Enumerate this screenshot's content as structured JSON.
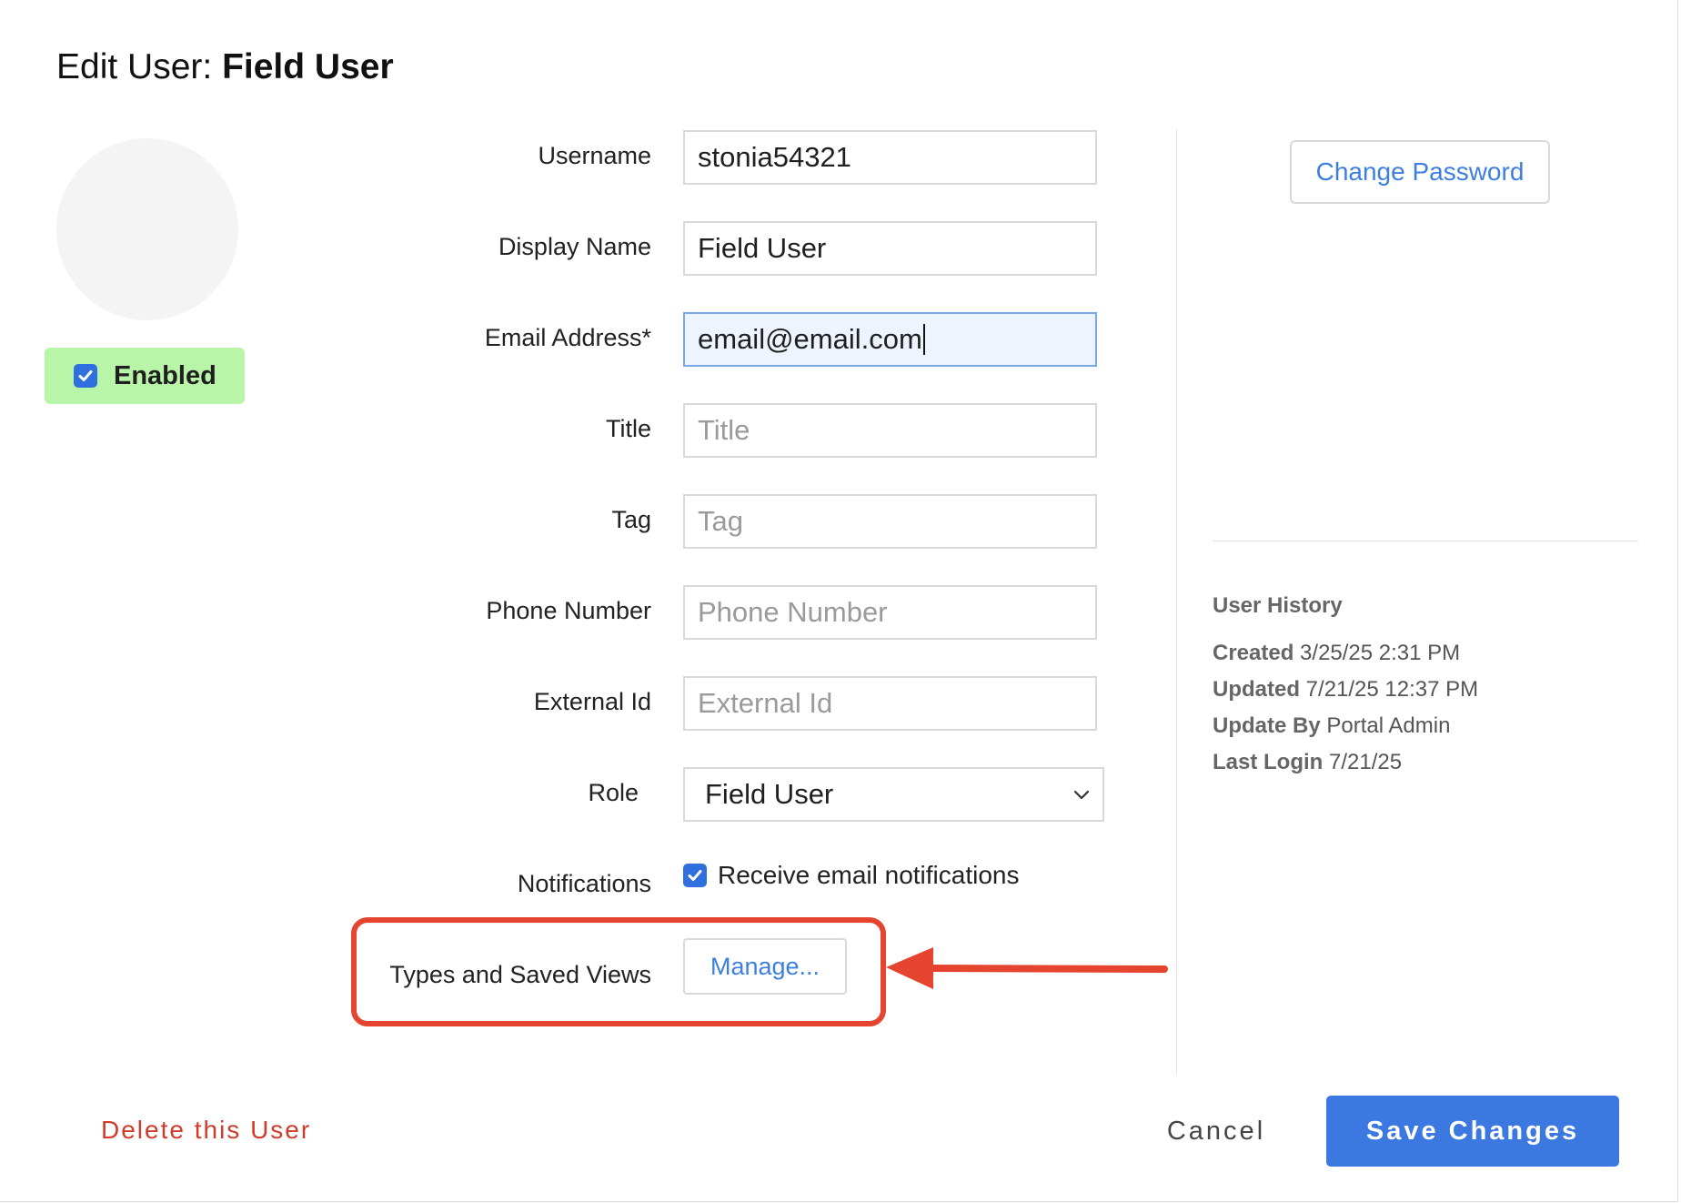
{
  "dialog": {
    "title_prefix": "Edit User: ",
    "title_name": "Field User"
  },
  "status": {
    "enabled_label": "Enabled",
    "enabled_checked": true
  },
  "form": {
    "username": {
      "label": "Username",
      "value": "stonia54321"
    },
    "display_name": {
      "label": "Display Name",
      "value": "Field User"
    },
    "email": {
      "label": "Email Address*",
      "value": "email@email.com"
    },
    "title": {
      "label": "Title",
      "placeholder": "Title"
    },
    "tag": {
      "label": "Tag",
      "placeholder": "Tag"
    },
    "phone": {
      "label": "Phone Number",
      "placeholder": "Phone Number"
    },
    "external_id": {
      "label": "External Id",
      "placeholder": "External Id"
    },
    "role": {
      "label": "Role",
      "value": "Field User"
    },
    "notifications": {
      "label": "Notifications",
      "checkbox_label": "Receive email notifications",
      "checked": true
    },
    "types_views": {
      "label": "Types and Saved Views",
      "button_label": "Manage..."
    }
  },
  "sidebar": {
    "change_password_label": "Change Password",
    "history": {
      "title": "User History",
      "created_label": "Created",
      "created_value": "3/25/25 2:31 PM",
      "updated_label": "Updated",
      "updated_value": "7/21/25 12:37 PM",
      "update_by_label": "Update By",
      "update_by_value": "Portal Admin",
      "last_login_label": "Last Login",
      "last_login_value": "7/21/25"
    }
  },
  "footer": {
    "delete_label": "Delete this User",
    "cancel_label": "Cancel",
    "save_label": "Save Changes"
  },
  "colors": {
    "accent": "#3b78e0",
    "link": "#3d7fe0",
    "danger": "#d13b2b",
    "enabled_bg": "#b9f5a8",
    "annotation": "#e5452f"
  },
  "icons": {
    "enabled_checkbox": "check-icon",
    "notifications_checkbox": "check-icon",
    "role_dropdown": "chevron-down-icon",
    "annotation_arrow": "arrow-left-icon"
  }
}
